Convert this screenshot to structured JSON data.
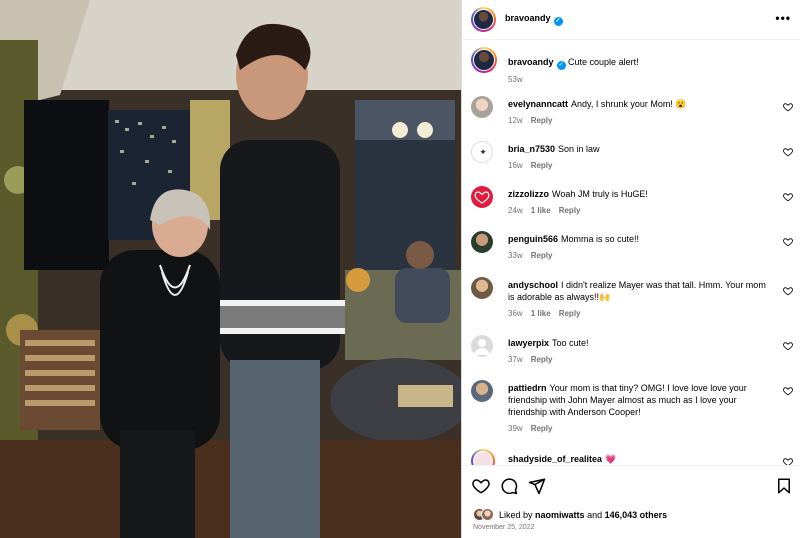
{
  "post": {
    "username": "bravoandy",
    "more_label": "•••"
  },
  "caption": {
    "username": "bravoandy",
    "text": "Cute couple alert!",
    "age": "53w"
  },
  "comments": [
    {
      "username": "evelynanncatt",
      "text": "Andy, I shrunk your Mom! 😮",
      "age": "12w",
      "likes": "",
      "reply": "Reply"
    },
    {
      "username": "bria_n7530",
      "text": "Son in law",
      "age": "16w",
      "likes": "",
      "reply": "Reply"
    },
    {
      "username": "zizzolizzo",
      "text": "Woah JM truly is HuGE!",
      "age": "24w",
      "likes": "1 like",
      "reply": "Reply"
    },
    {
      "username": "penguin566",
      "text": "Momma is so cute!!",
      "age": "33w",
      "likes": "",
      "reply": "Reply"
    },
    {
      "username": "andyschool",
      "text": "I didn't realize Mayer was that tall. Hmm. Your mom is adorable as always!!🙌",
      "age": "36w",
      "likes": "1 like",
      "reply": "Reply"
    },
    {
      "username": "lawyerpix",
      "text": "Too cute!",
      "age": "37w",
      "likes": "",
      "reply": "Reply"
    },
    {
      "username": "pattiedrn",
      "text": "Your mom is that tiny? OMG! I love love love your friendship with John Mayer almost as much as I love your friendship with Anderson Cooper!",
      "age": "39w",
      "likes": "",
      "reply": "Reply"
    },
    {
      "username": "shadyside_of_realitea",
      "text": "💗",
      "age": "",
      "likes": "",
      "reply": ""
    }
  ],
  "footer": {
    "liked_prefix": "Liked by",
    "liked_user": "naomiwatts",
    "liked_and": "and",
    "liked_count": "146,043 others",
    "date": "November 25, 2022"
  },
  "icons": {
    "verified": "verified-badge-icon",
    "like": "heart-outline-icon",
    "comment": "comment-bubble-icon",
    "share": "paper-plane-icon",
    "save": "bookmark-icon"
  },
  "colors": {
    "verified": "#0095f6",
    "meta_text": "#737373",
    "border": "#dbdbdb"
  }
}
